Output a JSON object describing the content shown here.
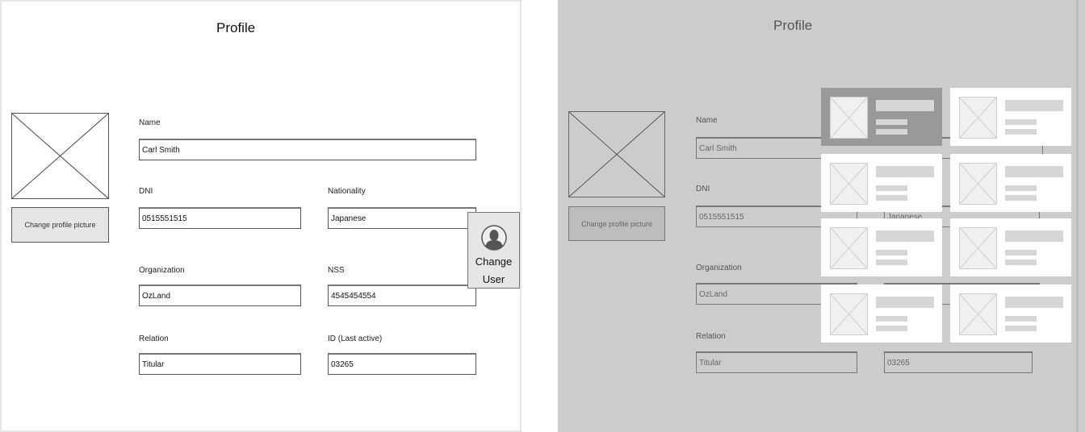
{
  "screens": [
    {
      "id": "profile",
      "title": "Profile",
      "change_picture_label": "Change profile picture",
      "fields": {
        "name": {
          "label": "Name",
          "value": "Carl Smith"
        },
        "dni": {
          "label": "DNI",
          "value": "0515551515"
        },
        "nationality": {
          "label": "Nationality",
          "value": "Japanese"
        },
        "organization": {
          "label": "Organization",
          "value": "OzLand"
        },
        "nss": {
          "label": "NSS",
          "value": "4545454554"
        },
        "relation": {
          "label": "Relation",
          "value": "Titular"
        },
        "id_last_active": {
          "label": "ID (Last active)",
          "value": "03265"
        }
      },
      "change_user": {
        "icon": "user-avatar-icon",
        "label_line1": "Change",
        "label_line2": "User"
      }
    },
    {
      "id": "profile-user-picker",
      "title": "Profile",
      "change_picture_label": "Change profile picture",
      "fields": {
        "name": {
          "label": "Name",
          "value": "Carl Smith"
        },
        "dni": {
          "label": "DNI",
          "value": "0515551515"
        },
        "nationality": {
          "value": "Japanese"
        },
        "organization": {
          "label": "Organization",
          "value": "OzLand"
        },
        "relation": {
          "label": "Relation",
          "value": "Titular"
        },
        "id_last_active": {
          "value": "03265"
        }
      },
      "user_picker": {
        "columns": 2,
        "rows": 4,
        "selected_index": 0,
        "cards": 8,
        "card_icon": "image-placeholder-icon"
      }
    }
  ],
  "colors": {
    "overlay_background": "#cccccc",
    "card_selected": "#999999",
    "card_default": "#ffffff",
    "placeholder_bar": "#d6d6d6"
  }
}
